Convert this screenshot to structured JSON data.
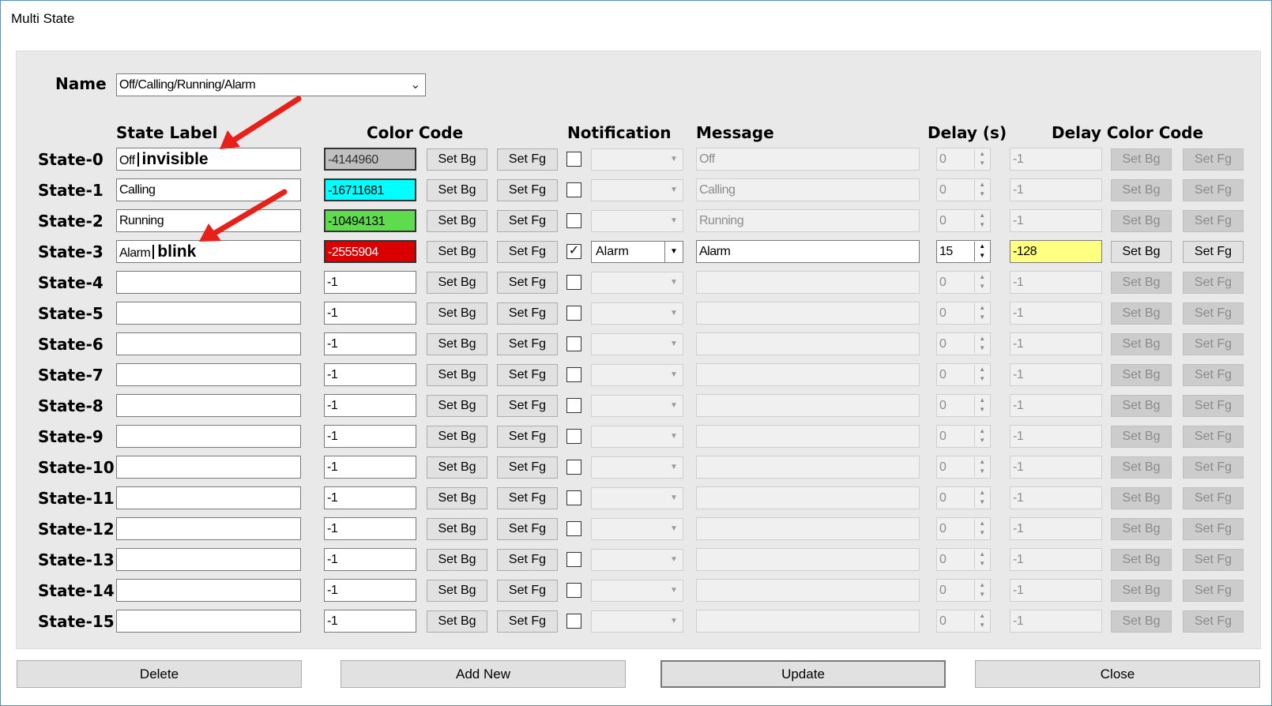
{
  "window": {
    "title": "Multi State"
  },
  "name": {
    "label": "Name",
    "value": "Off/Calling/Running/Alarm"
  },
  "headers": {
    "state_label": "State Label",
    "color_code": "Color Code",
    "notification": "Notification",
    "message": "Message",
    "delay": "Delay (s)",
    "delay_color_code": "Delay Color Code"
  },
  "buttons": {
    "set_bg": "Set Bg",
    "set_fg": "Set Fg"
  },
  "states": [
    {
      "name": "State-0",
      "label": "Off",
      "label_suffix": "invisible",
      "color": "-4144960",
      "color_bg": "#c0c0c0",
      "notify": false,
      "notification": "",
      "message": "Off",
      "delay": "0",
      "delay_color": "-1",
      "delay_color_bg": ""
    },
    {
      "name": "State-1",
      "label": "Calling",
      "label_suffix": "",
      "color": "-16711681",
      "color_bg": "#00ffff",
      "notify": false,
      "notification": "",
      "message": "Calling",
      "delay": "0",
      "delay_color": "-1",
      "delay_color_bg": ""
    },
    {
      "name": "State-2",
      "label": "Running",
      "label_suffix": "",
      "color": "-10494131",
      "color_bg": "#5fdc4d",
      "notify": false,
      "notification": "",
      "message": "Running",
      "delay": "0",
      "delay_color": "-1",
      "delay_color_bg": ""
    },
    {
      "name": "State-3",
      "label": "Alarm",
      "label_suffix": "blink",
      "color": "-2555904",
      "color_bg": "#d90000",
      "notify": true,
      "notification": "Alarm",
      "message": "Alarm",
      "delay": "15",
      "delay_color": "-128",
      "delay_color_bg": "#ffff80"
    },
    {
      "name": "State-4",
      "label": "",
      "label_suffix": "",
      "color": "-1",
      "color_bg": "",
      "notify": false,
      "notification": "",
      "message": "",
      "delay": "0",
      "delay_color": "-1",
      "delay_color_bg": ""
    },
    {
      "name": "State-5",
      "label": "",
      "label_suffix": "",
      "color": "-1",
      "color_bg": "",
      "notify": false,
      "notification": "",
      "message": "",
      "delay": "0",
      "delay_color": "-1",
      "delay_color_bg": ""
    },
    {
      "name": "State-6",
      "label": "",
      "label_suffix": "",
      "color": "-1",
      "color_bg": "",
      "notify": false,
      "notification": "",
      "message": "",
      "delay": "0",
      "delay_color": "-1",
      "delay_color_bg": ""
    },
    {
      "name": "State-7",
      "label": "",
      "label_suffix": "",
      "color": "-1",
      "color_bg": "",
      "notify": false,
      "notification": "",
      "message": "",
      "delay": "0",
      "delay_color": "-1",
      "delay_color_bg": ""
    },
    {
      "name": "State-8",
      "label": "",
      "label_suffix": "",
      "color": "-1",
      "color_bg": "",
      "notify": false,
      "notification": "",
      "message": "",
      "delay": "0",
      "delay_color": "-1",
      "delay_color_bg": ""
    },
    {
      "name": "State-9",
      "label": "",
      "label_suffix": "",
      "color": "-1",
      "color_bg": "",
      "notify": false,
      "notification": "",
      "message": "",
      "delay": "0",
      "delay_color": "-1",
      "delay_color_bg": ""
    },
    {
      "name": "State-10",
      "label": "",
      "label_suffix": "",
      "color": "-1",
      "color_bg": "",
      "notify": false,
      "notification": "",
      "message": "",
      "delay": "0",
      "delay_color": "-1",
      "delay_color_bg": ""
    },
    {
      "name": "State-11",
      "label": "",
      "label_suffix": "",
      "color": "-1",
      "color_bg": "",
      "notify": false,
      "notification": "",
      "message": "",
      "delay": "0",
      "delay_color": "-1",
      "delay_color_bg": ""
    },
    {
      "name": "State-12",
      "label": "",
      "label_suffix": "",
      "color": "-1",
      "color_bg": "",
      "notify": false,
      "notification": "",
      "message": "",
      "delay": "0",
      "delay_color": "-1",
      "delay_color_bg": ""
    },
    {
      "name": "State-13",
      "label": "",
      "label_suffix": "",
      "color": "-1",
      "color_bg": "",
      "notify": false,
      "notification": "",
      "message": "",
      "delay": "0",
      "delay_color": "-1",
      "delay_color_bg": ""
    },
    {
      "name": "State-14",
      "label": "",
      "label_suffix": "",
      "color": "-1",
      "color_bg": "",
      "notify": false,
      "notification": "",
      "message": "",
      "delay": "0",
      "delay_color": "-1",
      "delay_color_bg": ""
    },
    {
      "name": "State-15",
      "label": "",
      "label_suffix": "",
      "color": "-1",
      "color_bg": "",
      "notify": false,
      "notification": "",
      "message": "",
      "delay": "0",
      "delay_color": "-1",
      "delay_color_bg": ""
    }
  ],
  "footer": {
    "delete": "Delete",
    "add_new": "Add New",
    "update": "Update",
    "close": "Close"
  },
  "colors": {
    "annotation_arrow": "#e8201a",
    "panel": "#e9e9e9",
    "window_border": "#5a8fc7"
  }
}
